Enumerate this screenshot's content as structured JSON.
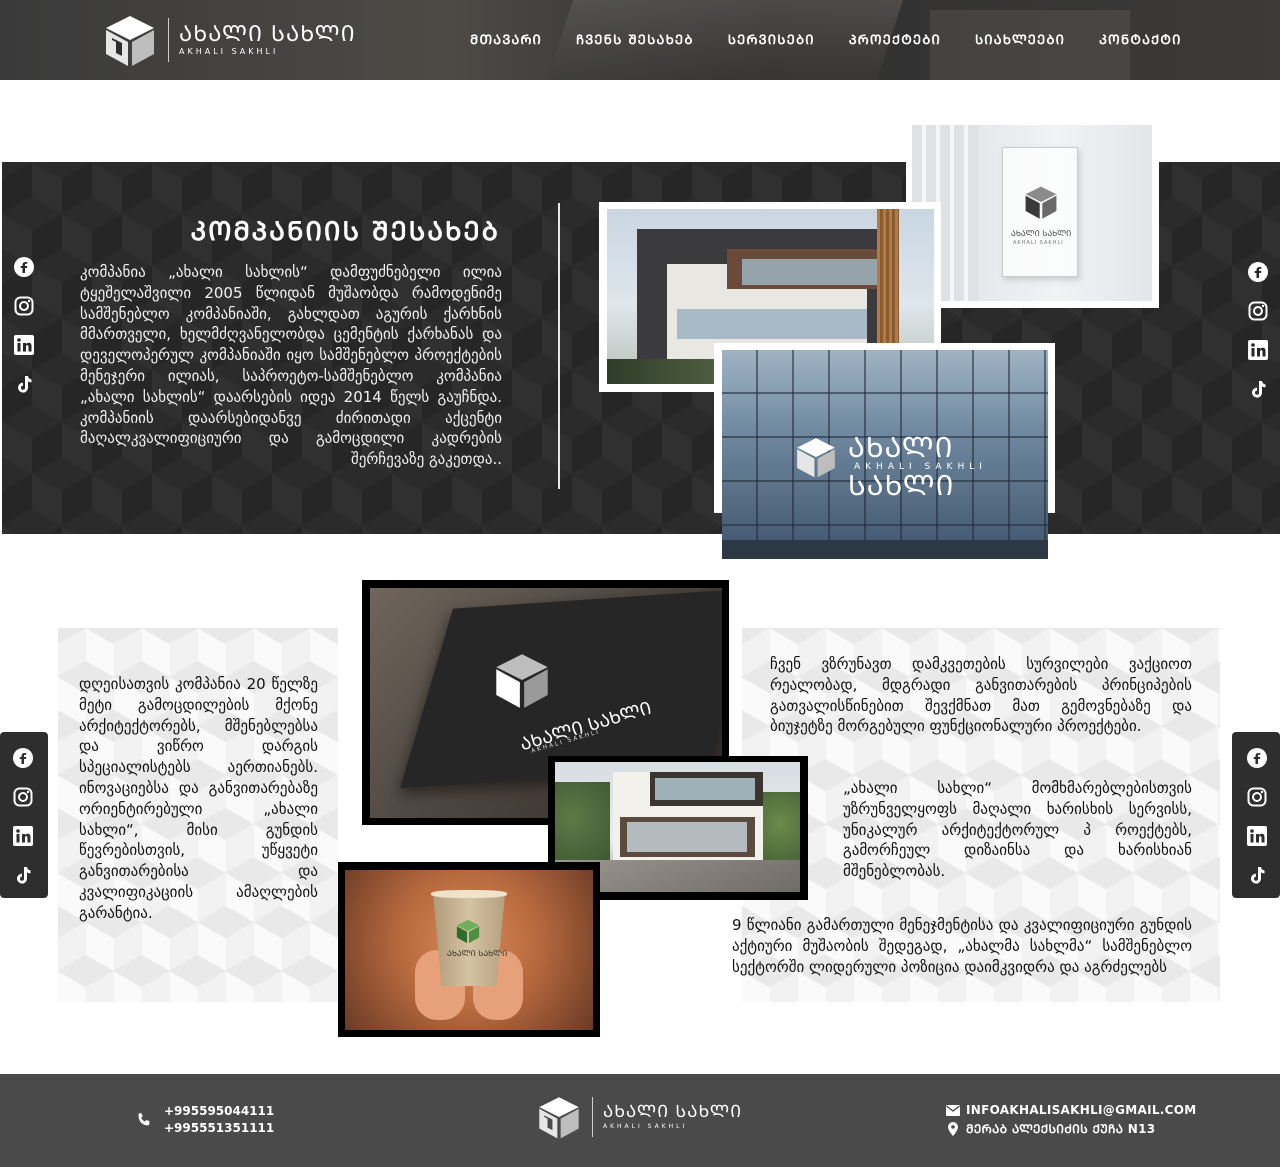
{
  "brand": {
    "logo_main": "ᲐᲮᲐᲚᲘ ᲡᲐᲮᲚᲘ",
    "logo_sub": "AKHALI SAKHLI"
  },
  "nav": {
    "items": [
      {
        "label": "ᲛᲗᲐᲕᲐᲠᲘ"
      },
      {
        "label": "ᲩᲕᲔᲜᲡ ᲨᲔᲡᲐᲮᲔᲑ"
      },
      {
        "label": "ᲡᲔᲠᲕᲘᲡᲔᲑᲘ"
      },
      {
        "label": "ᲞᲠᲝᲔᲥᲢᲔᲑᲘ"
      },
      {
        "label": "ᲡᲘᲐᲮᲚᲔᲔᲑᲘ"
      },
      {
        "label": "ᲙᲝᲜᲢᲐᲥᲢᲘ"
      }
    ]
  },
  "about": {
    "title": "ᲙᲝᲛᲞᲐᲜᲘᲘᲡ ᲨᲔᲡᲐᲮᲔᲑ",
    "text": "კომპანია „ახალი სახლის“ დამფუძნებელი ილია ტყეშელაშვილი 2005 წლიდან მუშაობდა რამოდენიმე სამშენებლო კომპანიაში, გახლდათ აგურის ქარხნის მმართველი, ხელმძღვანელობდა ცემენტის ქარხანას და დეველოპერულ კომპანიაში იყო სამშენებლო პროექტების მენეჯერი ილიას, საპროეტო-სამშენებლო კომპანია „ახალი სახლის“ დაარსების იდეა 2014 წელს გაუჩნდა. კომპანიის დაარსებიდანვე ძირითადი აქცენტი მაღალკვალიფიციური და გამოცდილი კადრების შერჩევაზე გაკეთდა.."
  },
  "social": {
    "left": [
      "facebook-icon",
      "instagram-icon",
      "linkedin-icon",
      "tiktok-icon"
    ],
    "right": [
      "facebook-icon",
      "instagram-icon",
      "linkedin-icon",
      "tiktok-icon"
    ]
  },
  "photos": {
    "sign_logo_main": "ᲐᲮᲐᲚᲘ ᲡᲐᲮᲚᲘ",
    "sign_logo_sub": "AKHALI SAKHLI"
  },
  "section2": {
    "left_text": "დღეისათვის კომპანია 20 წელზე მეტი გამოცდილების მქონე არქიტექტორებს, მშენებლებსა და ვიწრო დარგის სპეციალისტებს აერთიანებს. ინოვაციებსა და განვითარებაზე ორიენტირებული „ახალი სახლი“, მისი გუნდის წევრებისთვის, უწყვეტი განვითარებისა და კვალიფიკაციის ამაღლების გარანტია.",
    "right_text_1": "ჩვენ ვზრუნავთ დამკვეთების სურვილები ვაქციოთ რეალობად, მდგრადი განვითარების პრინციპების გათვალისწინებით შევქმნათ მათ გემოვნებაზე და ბიუჯეტზე მორგებული ფუნქციონალური პროექტები.",
    "right_text_2": "„ახალი სახლი“ მომხმარებლებისთვის უზრუნველყოფს მაღალი ხარისხის სერვისს, უნიკალურ არქიტექტორულ პ როექტებს, გამორჩეულ დიზაინსა და ხარისხიან მშენებლობას.",
    "right_text_3": "9 წლიანი გამართული მენეჯმენტისა და კვალიფიციური გუნდის აქტიური მუშაობის შედეგად, „ახალმა სახლმა“ სამშენებლო სექტორში ლიდერული პოზიცია დაიმკვიდრა და აგრძელებს"
  },
  "footer": {
    "phone_1": "+995595044111",
    "phone_2": "+995551351111",
    "email": "INFOAKHALISAKHLI@GMAIL.COM",
    "address": "ᲛᲔᲠᲐᲑ ᲐᲚᲔᲥᲡᲘᲫᲘᲡ ᲥᲣᲩᲐ N13"
  },
  "colors": {
    "dark_band": "#262626",
    "footer": "#4a4a4a",
    "accent_green": "#3f7d3a"
  }
}
